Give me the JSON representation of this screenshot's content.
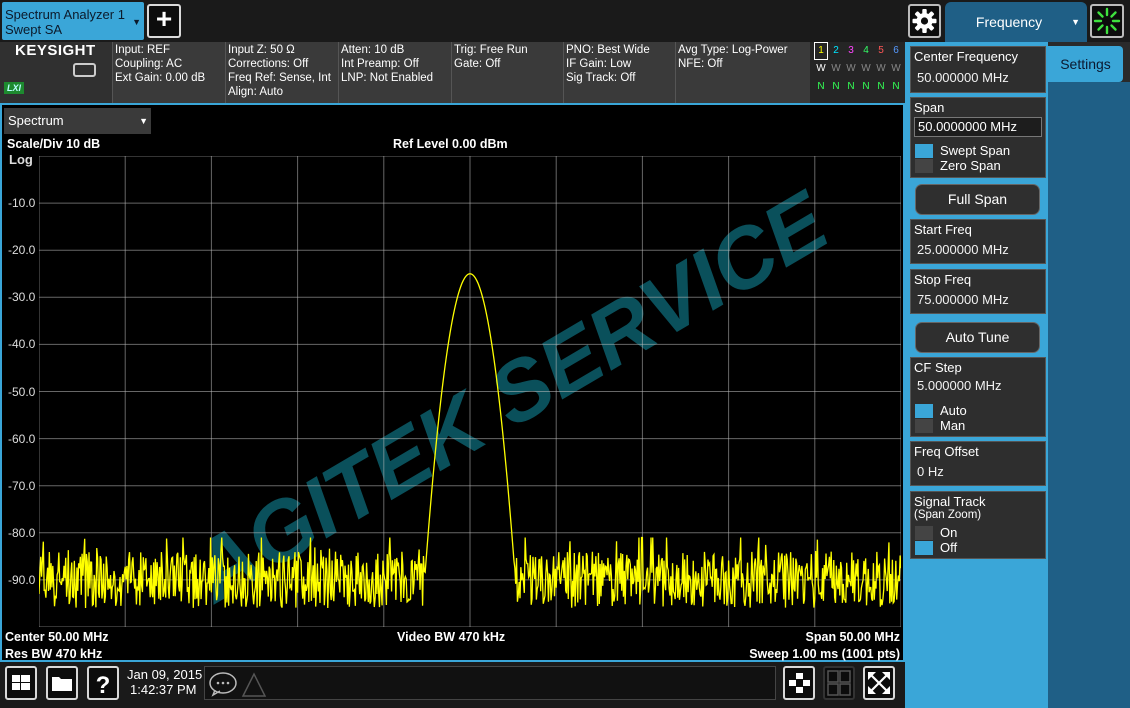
{
  "app_tab": {
    "line1": "Spectrum Analyzer 1",
    "line2": "Swept SA"
  },
  "add_button": "+",
  "menu_tab": "Frequency",
  "side_tab": "Settings",
  "brand": {
    "name": "KEYSIGHT",
    "lxi": "LXI"
  },
  "settings_groups": [
    [
      "Input: REF",
      "Coupling: AC",
      "Ext Gain: 0.00 dB"
    ],
    [
      "Input Z: 50 Ω",
      "Corrections: Off",
      "Freq Ref: Sense, Int",
      "Align: Auto"
    ],
    [
      "Atten: 10 dB",
      "Int Preamp: Off",
      "LNP: Not Enabled"
    ],
    [
      "Trig: Free Run",
      "Gate: Off"
    ],
    [
      "PNO: Best Wide",
      "IF Gain: Low",
      "Sig Track: Off"
    ],
    [
      "Avg Type: Log-Power",
      "NFE: Off"
    ]
  ],
  "traces": {
    "numbers": [
      "1",
      "2",
      "3",
      "4",
      "5",
      "6"
    ],
    "numbercolors": [
      "#ffff00",
      "#00e5ff",
      "#ff44ff",
      "#33ff66",
      "#ff5555",
      "#5599ff"
    ],
    "types": [
      "W",
      "W",
      "W",
      "W",
      "W",
      "W"
    ],
    "detectors": [
      "N",
      "N",
      "N",
      "N",
      "N",
      "N"
    ]
  },
  "spectrum": {
    "dropdown": "Spectrum",
    "scale_div": "Scale/Div 10 dB",
    "log": "Log",
    "ref_level": "Ref Level 0.00 dBm",
    "y_ticks": [
      "-10.0",
      "-20.0",
      "-30.0",
      "-40.0",
      "-50.0",
      "-60.0",
      "-70.0",
      "-80.0",
      "-90.0"
    ],
    "center": "Center 50.00 MHz",
    "res_bw": "Res BW 470 kHz",
    "video_bw": "Video BW 470 kHz",
    "span": "Span 50.00 MHz",
    "sweep": "Sweep 1.00 ms (1001 pts)",
    "watermark": "AGITEK SERVICE"
  },
  "chart_data": {
    "type": "line",
    "title": "Ref Level 0.00 dBm",
    "xlabel": "Center 50.00 MHz",
    "ylabel": "",
    "x_unit": "MHz",
    "y_unit": "dBm",
    "xlim": [
      25,
      75
    ],
    "ylim": [
      -100,
      0
    ],
    "grid": true,
    "points": 1001,
    "noise_floor_dbm": -90,
    "noise_peak_dbm": -81,
    "series": [
      {
        "name": "",
        "color": "#ffff00",
        "peak_freq_mhz": 50.0,
        "peak_dbm": -25,
        "peak_width_mhz": 1.6
      }
    ]
  },
  "softkeys": {
    "center_freq": {
      "label": "Center Frequency",
      "value": "50.000000 MHz"
    },
    "span": {
      "label": "Span",
      "value": "50.0000000 MHz",
      "opt1": "Swept Span",
      "opt2": "Zero Span"
    },
    "full_span": "Full Span",
    "start_freq": {
      "label": "Start Freq",
      "value": "25.000000 MHz"
    },
    "stop_freq": {
      "label": "Stop Freq",
      "value": "75.000000 MHz"
    },
    "auto_tune": "Auto Tune",
    "cf_step": {
      "label": "CF Step",
      "value": "5.000000 MHz",
      "opt1": "Auto",
      "opt2": "Man"
    },
    "freq_offset": {
      "label": "Freq Offset",
      "value": "0 Hz"
    },
    "signal_track": {
      "label": "Signal Track",
      "sublabel": "(Span Zoom)",
      "opt1": "On",
      "opt2": "Off"
    }
  },
  "status": {
    "date": "Jan 09, 2015",
    "time": "1:42:37 PM"
  },
  "colors": {
    "accent": "#3aa6d8",
    "trace": "#ffff00",
    "grid": "#bbbbbb",
    "watermark": "#0e6b7a"
  }
}
